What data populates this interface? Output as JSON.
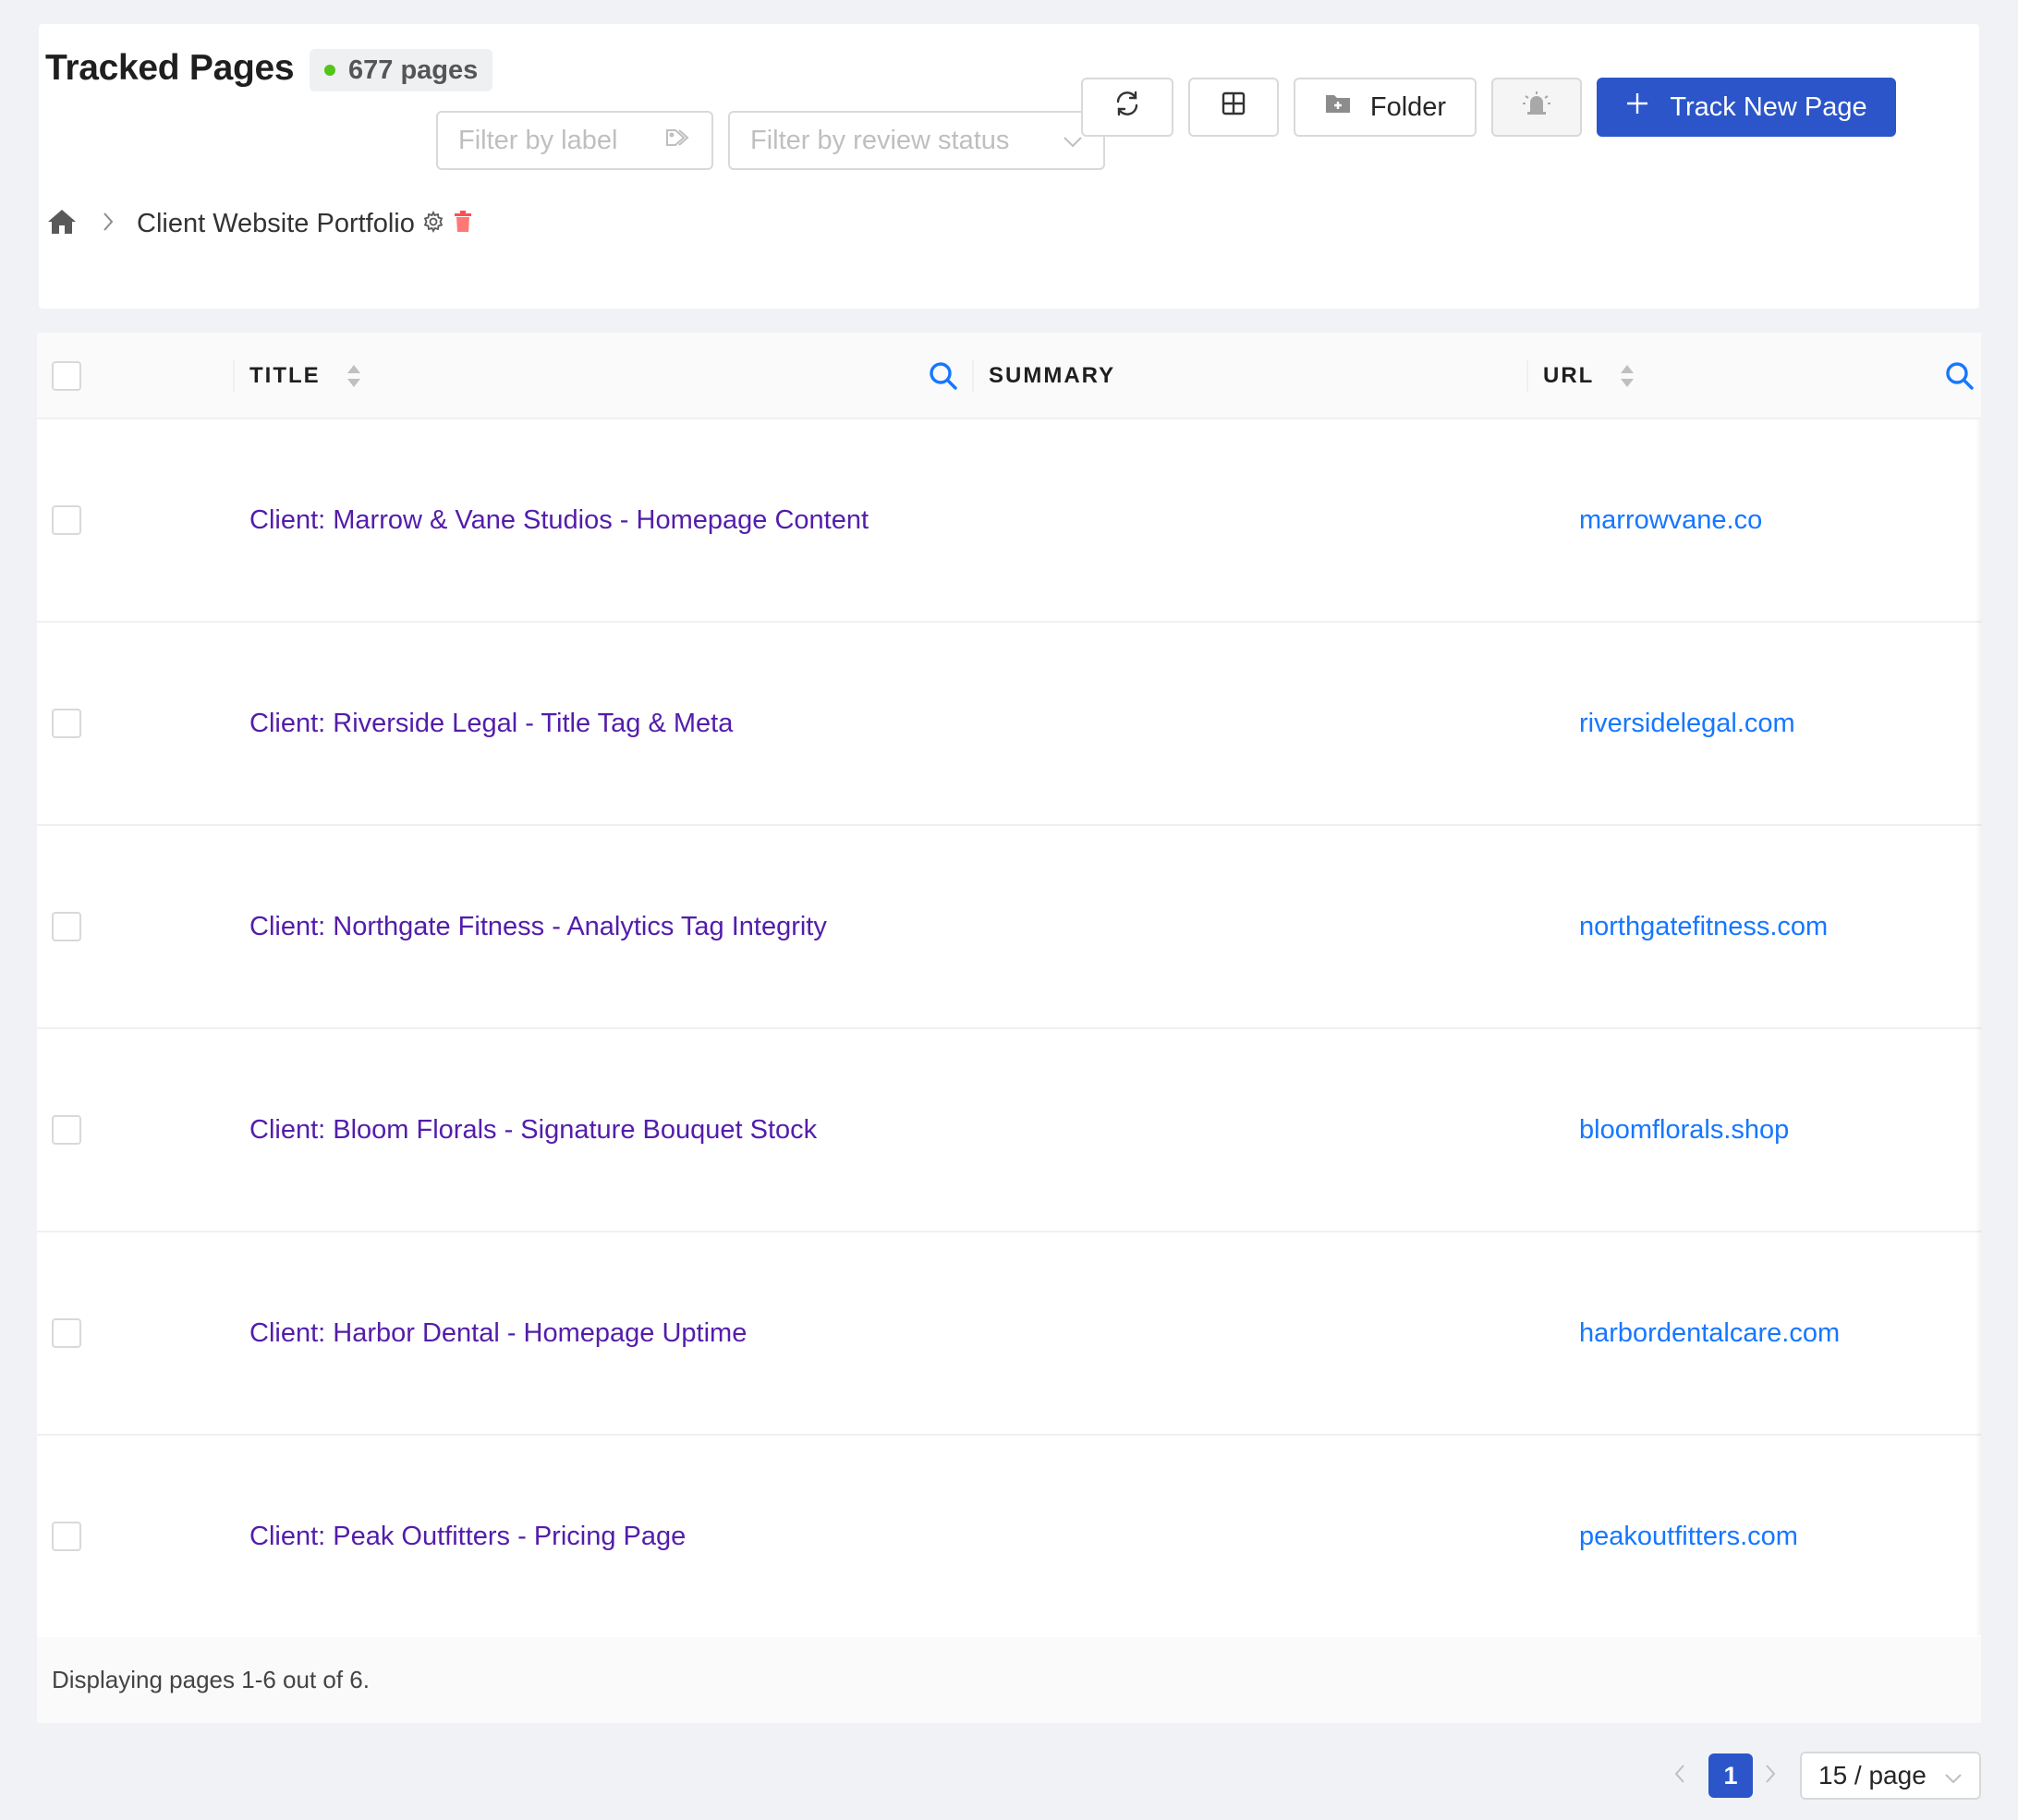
{
  "header": {
    "title": "Tracked Pages",
    "count_label": "677 pages",
    "status_color": "#52c41a"
  },
  "filters": {
    "label_placeholder": "Filter by label",
    "review_placeholder": "Filter by review status"
  },
  "toolbar": {
    "refresh_icon": "refresh-icon",
    "layout_icon": "grid-layout-icon",
    "folder_label": "Folder",
    "alert_icon": "alarm-bell-icon",
    "track_label": "Track New Page",
    "accent_color": "#2b55c9"
  },
  "breadcrumb": {
    "home_icon": "home-icon",
    "current": "Client Website Portfolio"
  },
  "table": {
    "columns": {
      "title": "TITLE",
      "summary": "SUMMARY",
      "url": "URL"
    },
    "rows": [
      {
        "title": "Client: Marrow & Vane Studios - Homepage Content",
        "summary": "",
        "url": "marrowvane.co"
      },
      {
        "title": "Client: Riverside Legal - Title Tag & Meta",
        "summary": "",
        "url": "riversidelegal.com"
      },
      {
        "title": "Client: Northgate Fitness - Analytics Tag Integrity",
        "summary": "",
        "url": "northgatefitness.com"
      },
      {
        "title": "Client: Bloom Florals - Signature Bouquet Stock",
        "summary": "",
        "url": "bloomflorals.shop"
      },
      {
        "title": "Client: Harbor Dental - Homepage Uptime",
        "summary": "",
        "url": "harbordentalcare.com"
      },
      {
        "title": "Client: Peak Outfitters - Pricing Page",
        "summary": "",
        "url": "peakoutfitters.com"
      }
    ],
    "footer_text": "Displaying pages 1-6 out of 6."
  },
  "pagination": {
    "current_page": "1",
    "page_size": "15 / page"
  }
}
